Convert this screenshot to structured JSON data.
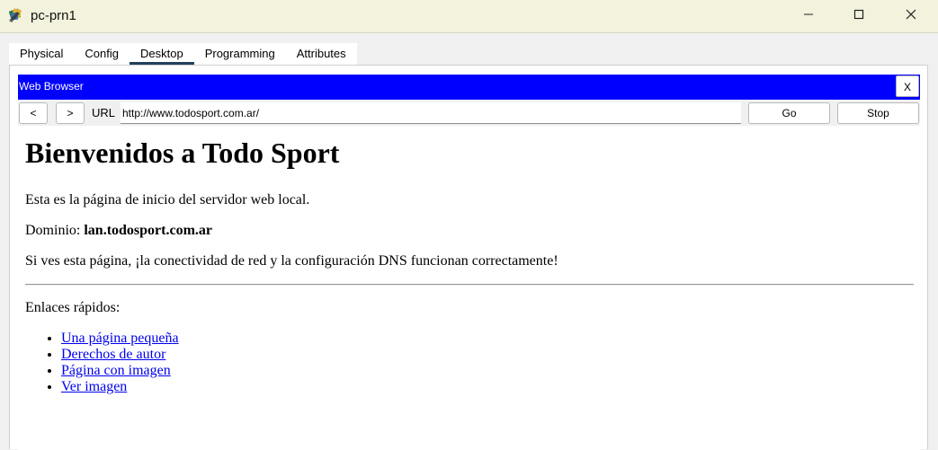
{
  "window": {
    "title": "pc-prn1"
  },
  "tabs": [
    {
      "label": "Physical",
      "active": false
    },
    {
      "label": "Config",
      "active": false
    },
    {
      "label": "Desktop",
      "active": true
    },
    {
      "label": "Programming",
      "active": false
    },
    {
      "label": "Attributes",
      "active": false
    }
  ],
  "browser": {
    "title": "Web Browser",
    "close_label": "X",
    "back_label": "<",
    "forward_label": ">",
    "url_label": "URL",
    "url_value": "http://www.todosport.com.ar/",
    "go_label": "Go",
    "stop_label": "Stop",
    "header_color": "#0000ff"
  },
  "page": {
    "heading": "Bienvenidos a Todo Sport",
    "intro": "Esta es la página de inicio del servidor web local.",
    "domain_label": "Dominio: ",
    "domain_value": "lan.todosport.com.ar",
    "success": "Si ves esta página, ¡la conectividad de red y la configuración DNS funcionan correctamente!",
    "links_title": "Enlaces rápidos:",
    "links": [
      {
        "label": "Una página pequeña"
      },
      {
        "label": "Derechos de autor"
      },
      {
        "label": "Página con imagen"
      },
      {
        "label": "Ver imagen"
      }
    ]
  },
  "icons": {
    "app": "packet-tracer-pc-icon",
    "minimize": "minimize-icon",
    "maximize": "maximize-icon",
    "close": "close-icon"
  }
}
